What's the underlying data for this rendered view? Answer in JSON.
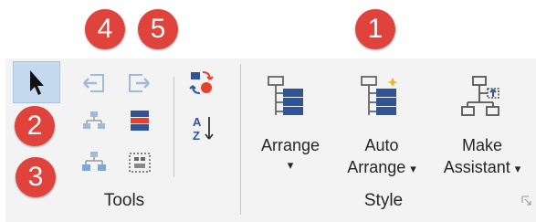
{
  "badges": [
    "4",
    "5",
    "1",
    "2",
    "3"
  ],
  "groups": {
    "tools_label": "Tools",
    "style_label": "Style"
  },
  "buttons": {
    "arrange": {
      "label": "Arrange",
      "caret": "▾"
    },
    "auto_arrange": {
      "line1": "Auto",
      "line2": "Arrange",
      "caret": "▾"
    },
    "make_assistant": {
      "line1": "Make",
      "line2": "Assistant",
      "caret": "▾"
    }
  },
  "icons": {
    "pointer": "pointer-icon",
    "move_left": "move-left-icon",
    "move_right": "move-right-icon",
    "select_hierarchy": "select-hierarchy-icon",
    "select_level": "select-level-icon",
    "select_branch": "select-branch-icon",
    "select_type": "select-type-icon",
    "swap": "swap-icon",
    "sort": "sort-az-icon",
    "arrange": "arrange-icon",
    "auto_arrange": "auto-arrange-icon",
    "make_assistant": "make-assistant-icon",
    "dialog_launcher": "dialog-launcher-icon"
  },
  "colors": {
    "badge": "#e0433b",
    "accent_blue": "#2b579a",
    "selected_bg": "#c4d8ee"
  }
}
